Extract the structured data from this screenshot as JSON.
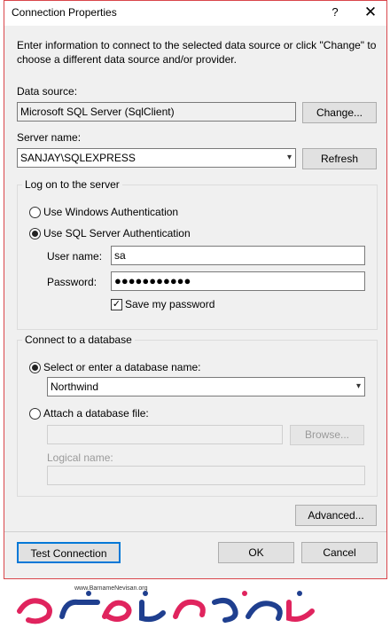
{
  "window": {
    "title": "Connection Properties",
    "help_glyph": "?",
    "close_glyph": "✕"
  },
  "instructions": "Enter information to connect to the selected data source or click \"Change\" to choose a different data source and/or provider.",
  "data_source": {
    "label": "Data source:",
    "value": "Microsoft SQL Server (SqlClient)",
    "change_button": "Change..."
  },
  "server": {
    "label": "Server name:",
    "value": "SANJAY\\SQLEXPRESS",
    "refresh_button": "Refresh"
  },
  "logon": {
    "group_title": "Log on to the server",
    "windows_auth": "Use Windows Authentication",
    "sql_auth": "Use SQL Server Authentication",
    "selected": "sql_auth",
    "username_label": "User name:",
    "username_value": "sa",
    "password_label": "Password:",
    "password_value": "●●●●●●●●●●●",
    "save_password_label": "Save my password",
    "save_password_checked": true
  },
  "database": {
    "group_title": "Connect to a database",
    "select_label": "Select or enter a database name:",
    "select_value": "Northwind",
    "attach_label": "Attach a database file:",
    "browse_button": "Browse...",
    "logical_name_label": "Logical name:",
    "selected": "select"
  },
  "footer": {
    "advanced_button": "Advanced...",
    "test_button": "Test Connection",
    "ok_button": "OK",
    "cancel_button": "Cancel"
  },
  "logo": {
    "url_text": "www.BarnameNevisan.org",
    "brand_colors": [
      "#e0245e",
      "#1f3f8f"
    ]
  }
}
